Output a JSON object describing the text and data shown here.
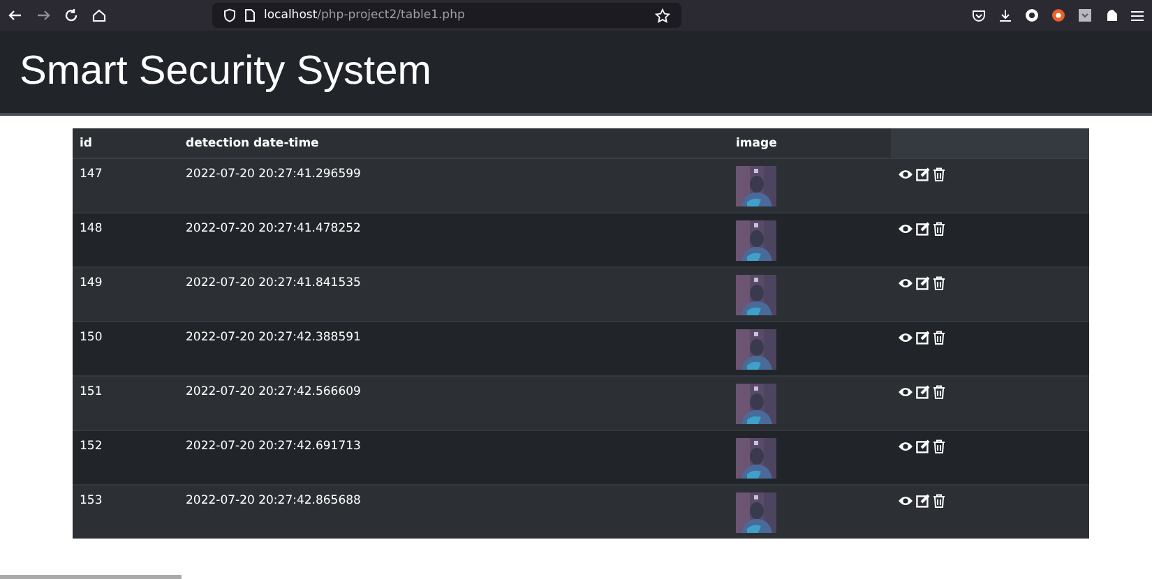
{
  "browser": {
    "url_host": "localhost",
    "url_path": "/php-project2/table1.php"
  },
  "header": {
    "title": "Smart Security System"
  },
  "table": {
    "columns": [
      "id",
      "detection date-time",
      "image"
    ],
    "rows": [
      {
        "id": "147",
        "detection_date_time": "2022-07-20 20:27:41.296599"
      },
      {
        "id": "148",
        "detection_date_time": "2022-07-20 20:27:41.478252"
      },
      {
        "id": "149",
        "detection_date_time": "2022-07-20 20:27:41.841535"
      },
      {
        "id": "150",
        "detection_date_time": "2022-07-20 20:27:42.388591"
      },
      {
        "id": "151",
        "detection_date_time": "2022-07-20 20:27:42.566609"
      },
      {
        "id": "152",
        "detection_date_time": "2022-07-20 20:27:42.691713"
      },
      {
        "id": "153",
        "detection_date_time": "2022-07-20 20:27:42.865688"
      }
    ]
  }
}
